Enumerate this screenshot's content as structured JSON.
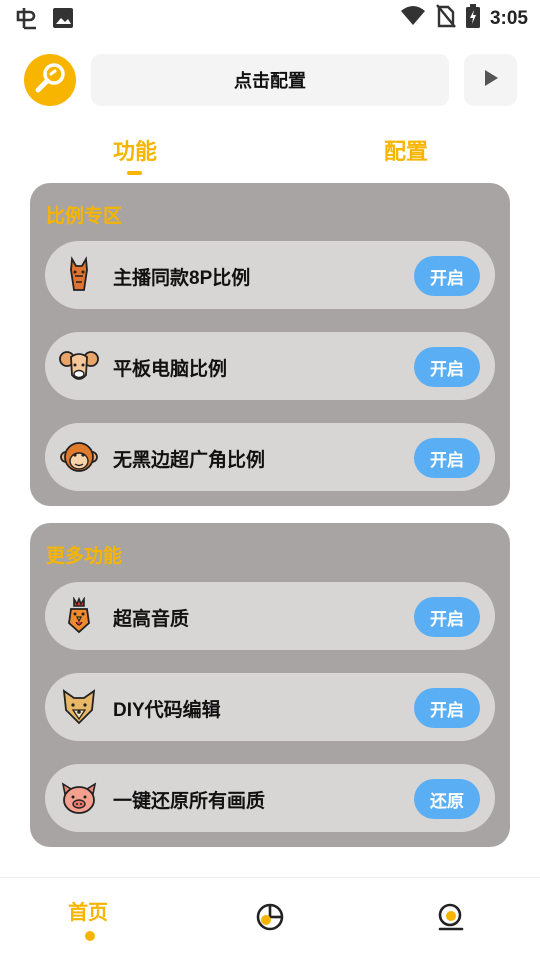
{
  "status_bar": {
    "time": "3:05",
    "left_icons": [
      "bug-icon",
      "image-icon"
    ],
    "right_icons": [
      "wifi-icon",
      "no-sim-icon",
      "battery-charging-icon"
    ]
  },
  "header": {
    "config_label": "点击配置",
    "logo_icon": "wrench-icon",
    "play_icon": "play-icon"
  },
  "tabs": {
    "function": "功能",
    "config": "配置"
  },
  "panels": [
    {
      "title": "比例专区",
      "items": [
        {
          "icon": "horse-icon",
          "label": "主播同款8P比例",
          "button": "开启"
        },
        {
          "icon": "ram-icon",
          "label": "平板电脑比例",
          "button": "开启"
        },
        {
          "icon": "monkey-icon",
          "label": "无黑边超广角比例",
          "button": "开启"
        }
      ]
    },
    {
      "title": "更多功能",
      "items": [
        {
          "icon": "rooster-icon",
          "label": "超高音质",
          "button": "开启"
        },
        {
          "icon": "dog-icon",
          "label": "DIY代码编辑",
          "button": "开启"
        },
        {
          "icon": "pig-icon",
          "label": "一键还原所有画质",
          "button": "还原"
        }
      ]
    }
  ],
  "bottom_nav": {
    "home": "首页",
    "icons": [
      "pie-chart-icon",
      "profile-icon"
    ]
  },
  "colors": {
    "accent": "#f7b500",
    "panel_bg": "#a8a4a3",
    "item_bg": "#d8d6d5",
    "button_bg": "#5aaef3"
  }
}
